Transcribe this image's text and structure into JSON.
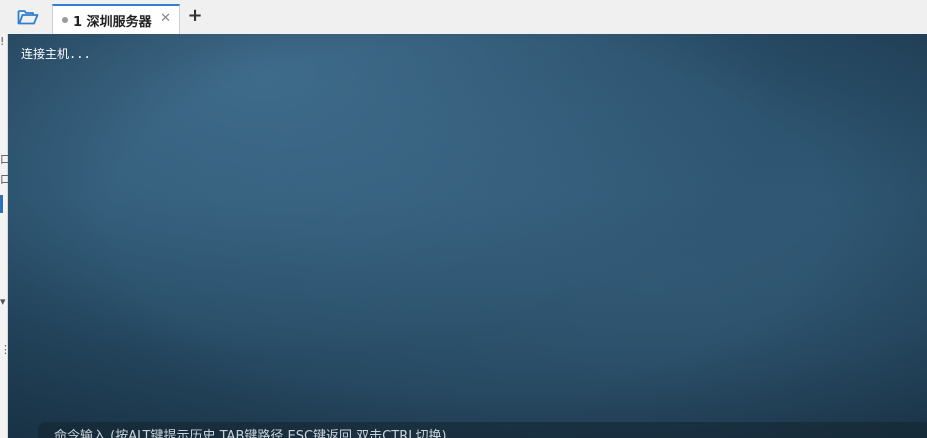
{
  "tabs": [
    {
      "number": "1",
      "label": "1 深圳服务器",
      "active": true
    }
  ],
  "terminal": {
    "output": "连接主机...",
    "command_placeholder": "命令输入 (按ALT键提示历史,TAB键路径,ESC键返回,双击CTRL切换)"
  },
  "colors": {
    "tab_accent": "#2f80d1",
    "terminal_bg": "#2c5470",
    "folder_icon": "#2f80d1"
  },
  "icons": {
    "open_folder": "folder-open-icon",
    "close_tab": "close-icon",
    "new_tab": "plus-icon"
  },
  "left_strip_marks": [
    "!",
    "口",
    "口",
    "▾",
    "⋮"
  ]
}
